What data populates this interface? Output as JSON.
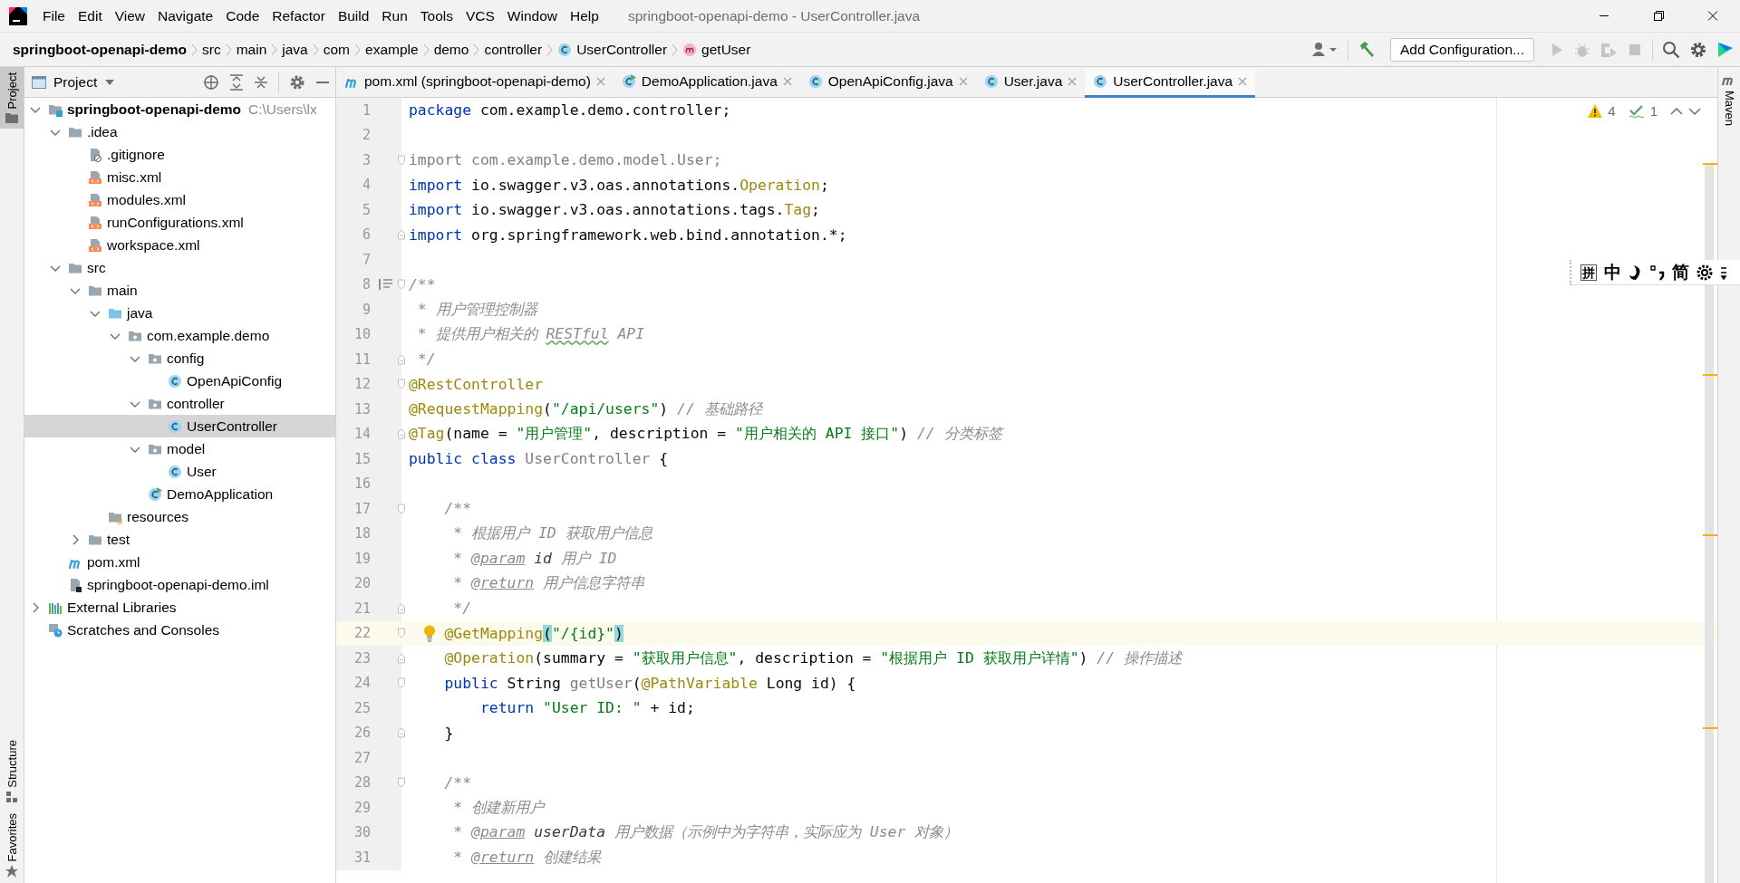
{
  "window": {
    "title": "springboot-openapi-demo - UserController.java"
  },
  "menu": [
    "File",
    "Edit",
    "View",
    "Navigate",
    "Code",
    "Refactor",
    "Build",
    "Run",
    "Tools",
    "VCS",
    "Window",
    "Help"
  ],
  "breadcrumbs": [
    {
      "label": "springboot-openapi-demo",
      "kind": "project"
    },
    {
      "label": "src",
      "kind": "dir"
    },
    {
      "label": "main",
      "kind": "dir"
    },
    {
      "label": "java",
      "kind": "dir"
    },
    {
      "label": "com",
      "kind": "dir"
    },
    {
      "label": "example",
      "kind": "dir"
    },
    {
      "label": "demo",
      "kind": "dir"
    },
    {
      "label": "controller",
      "kind": "dir"
    },
    {
      "label": "UserController",
      "kind": "class"
    },
    {
      "label": "getUser",
      "kind": "method"
    }
  ],
  "toolbar": {
    "run_config": "Add Configuration..."
  },
  "tool_stripe": {
    "left": {
      "top": [
        {
          "label": "Project",
          "selected": true
        }
      ],
      "bottom": [
        {
          "label": "Structure",
          "selected": false
        },
        {
          "label": "Favorites",
          "selected": false
        }
      ]
    },
    "right": {
      "top": [
        {
          "label": "Maven",
          "selected": false
        }
      ]
    }
  },
  "project_panel": {
    "title": "Project",
    "tree": [
      {
        "label": "springboot-openapi-demo",
        "kind": "module",
        "hint": "C:\\Users\\lx",
        "expanded": true,
        "selected": false,
        "children": [
          {
            "label": ".idea",
            "kind": "folder",
            "expanded": true,
            "selected": false,
            "children": [
              {
                "label": ".gitignore",
                "kind": "gitignore",
                "selected": false
              },
              {
                "label": "misc.xml",
                "kind": "xml",
                "selected": false
              },
              {
                "label": "modules.xml",
                "kind": "xml",
                "selected": false
              },
              {
                "label": "runConfigurations.xml",
                "kind": "xml",
                "selected": false
              },
              {
                "label": "workspace.xml",
                "kind": "xml",
                "selected": false
              }
            ]
          },
          {
            "label": "src",
            "kind": "folder",
            "expanded": true,
            "selected": false,
            "children": [
              {
                "label": "main",
                "kind": "folder",
                "expanded": true,
                "selected": false,
                "children": [
                  {
                    "label": "java",
                    "kind": "source",
                    "expanded": true,
                    "selected": false,
                    "children": [
                      {
                        "label": "com.example.demo",
                        "kind": "package",
                        "expanded": true,
                        "selected": false,
                        "children": [
                          {
                            "label": "config",
                            "kind": "package",
                            "expanded": true,
                            "selected": false,
                            "children": [
                              {
                                "label": "OpenApiConfig",
                                "kind": "class",
                                "selected": false
                              }
                            ]
                          },
                          {
                            "label": "controller",
                            "kind": "package",
                            "expanded": true,
                            "selected": false,
                            "children": [
                              {
                                "label": "UserController",
                                "kind": "class",
                                "selected": true
                              }
                            ]
                          },
                          {
                            "label": "model",
                            "kind": "package",
                            "expanded": true,
                            "selected": false,
                            "children": [
                              {
                                "label": "User",
                                "kind": "class",
                                "selected": false
                              }
                            ]
                          },
                          {
                            "label": "DemoApplication",
                            "kind": "app",
                            "selected": false
                          }
                        ]
                      }
                    ]
                  },
                  {
                    "label": "resources",
                    "kind": "resources",
                    "selected": false
                  }
                ]
              },
              {
                "label": "test",
                "kind": "folder",
                "expanded": false,
                "selected": false
              }
            ]
          },
          {
            "label": "pom.xml",
            "kind": "maven",
            "selected": false
          },
          {
            "label": "springboot-openapi-demo.iml",
            "kind": "iml",
            "selected": false
          }
        ]
      },
      {
        "label": "External Libraries",
        "kind": "libraries",
        "expanded": false,
        "selected": false
      },
      {
        "label": "Scratches and Consoles",
        "kind": "scratches",
        "selected": false
      }
    ]
  },
  "editor": {
    "tabs": [
      {
        "label": "pom.xml (springboot-openapi-demo)",
        "kind": "maven",
        "selected": false
      },
      {
        "label": "DemoApplication.java",
        "kind": "app",
        "selected": false
      },
      {
        "label": "OpenApiConfig.java",
        "kind": "class",
        "selected": false
      },
      {
        "label": "User.java",
        "kind": "class",
        "selected": false
      },
      {
        "label": "UserController.java",
        "kind": "class",
        "selected": true
      }
    ],
    "inspections": {
      "warnings": "4",
      "typos": "1"
    },
    "lines": [
      {
        "number": "1",
        "current": false,
        "tokens": [
          {
            "kind": "kw",
            "text": "package"
          },
          {
            "kind": "plain",
            "text": " com.example.demo.controller;"
          }
        ]
      },
      {
        "number": "2",
        "current": false
      },
      {
        "number": "3",
        "current": false,
        "fold": {
          "kind": "open"
        },
        "tokens": [
          {
            "kind": "unused",
            "text": "import com.example.demo.model.User;"
          }
        ]
      },
      {
        "number": "4",
        "current": false,
        "tokens": [
          {
            "kind": "kw",
            "text": "import"
          },
          {
            "kind": "plain",
            "text": " io.swagger.v3.oas.annotations."
          },
          {
            "kind": "ann",
            "text": "Operation"
          },
          {
            "kind": "plain",
            "text": ";"
          }
        ]
      },
      {
        "number": "5",
        "current": false,
        "tokens": [
          {
            "kind": "kw",
            "text": "import"
          },
          {
            "kind": "plain",
            "text": " io.swagger.v3.oas.annotations.tags."
          },
          {
            "kind": "ann",
            "text": "Tag"
          },
          {
            "kind": "plain",
            "text": ";"
          }
        ]
      },
      {
        "number": "6",
        "current": false,
        "fold": {
          "kind": "close"
        },
        "tokens": [
          {
            "kind": "kw",
            "text": "import"
          },
          {
            "kind": "plain",
            "text": " org.springframework.web.bind.annotation.*;"
          }
        ]
      },
      {
        "number": "7",
        "current": false
      },
      {
        "number": "8",
        "current": false,
        "fold": {
          "kind": "open"
        },
        "gutter_icon": {
          "kind": "doc"
        },
        "tokens": [
          {
            "kind": "cmt",
            "text": "/**"
          }
        ]
      },
      {
        "number": "9",
        "current": false,
        "tokens": [
          {
            "kind": "cmt",
            "text": " * 用户管理控制器"
          }
        ]
      },
      {
        "number": "10",
        "current": false,
        "tokens": [
          {
            "kind": "cmt",
            "text": " * 提供用户相关的 "
          },
          {
            "kind": "typo",
            "text": "RESTful"
          },
          {
            "kind": "cmt",
            "text": " API"
          }
        ]
      },
      {
        "number": "11",
        "current": false,
        "fold": {
          "kind": "close"
        },
        "tokens": [
          {
            "kind": "cmt",
            "text": " */"
          }
        ]
      },
      {
        "number": "12",
        "current": false,
        "fold": {
          "kind": "open"
        },
        "tokens": [
          {
            "kind": "ann",
            "text": "@RestController"
          }
        ]
      },
      {
        "number": "13",
        "current": false,
        "tokens": [
          {
            "kind": "ann",
            "text": "@RequestMapping"
          },
          {
            "kind": "plain",
            "text": "("
          },
          {
            "kind": "str",
            "text": "\"/api/users\""
          },
          {
            "kind": "plain",
            "text": ") "
          },
          {
            "kind": "cmt",
            "text": "// 基础路径"
          }
        ]
      },
      {
        "number": "14",
        "current": false,
        "fold": {
          "kind": "close"
        },
        "tokens": [
          {
            "kind": "ann",
            "text": "@Tag"
          },
          {
            "kind": "plain",
            "text": "(name = "
          },
          {
            "kind": "str",
            "text": "\"用户管理\""
          },
          {
            "kind": "plain",
            "text": ", description = "
          },
          {
            "kind": "str",
            "text": "\"用户相关的 API 接口\""
          },
          {
            "kind": "plain",
            "text": ") "
          },
          {
            "kind": "cmt",
            "text": "// 分类标签"
          }
        ]
      },
      {
        "number": "15",
        "current": false,
        "tokens": [
          {
            "kind": "kw",
            "text": "public class "
          },
          {
            "kind": "unused",
            "text": "UserController"
          },
          {
            "kind": "plain",
            "text": " {"
          }
        ]
      },
      {
        "number": "16",
        "current": false
      },
      {
        "number": "17",
        "current": false,
        "fold": {
          "kind": "open"
        },
        "tokens": [
          {
            "kind": "cmt",
            "text": "    /**"
          }
        ]
      },
      {
        "number": "18",
        "current": false,
        "tokens": [
          {
            "kind": "cmt",
            "text": "     * 根据用户 ID 获取用户信息"
          }
        ]
      },
      {
        "number": "19",
        "current": false,
        "tokens": [
          {
            "kind": "cmt",
            "text": "     * "
          },
          {
            "kind": "doctag",
            "text": "@param"
          },
          {
            "kind": "docid",
            "text": " id"
          },
          {
            "kind": "cmt",
            "text": " 用户 ID"
          }
        ]
      },
      {
        "number": "20",
        "current": false,
        "tokens": [
          {
            "kind": "cmt",
            "text": "     * "
          },
          {
            "kind": "doctag",
            "text": "@return"
          },
          {
            "kind": "cmt",
            "text": " 用户信息字符串"
          }
        ]
      },
      {
        "number": "21",
        "current": false,
        "fold": {
          "kind": "close"
        },
        "tokens": [
          {
            "kind": "cmt",
            "text": "     */"
          }
        ]
      },
      {
        "number": "22",
        "current": true,
        "fold": {
          "kind": "open"
        },
        "gutter_icon": {
          "kind": "bulb"
        },
        "tokens": [
          {
            "kind": "ann",
            "text": "    @GetMapping"
          },
          {
            "kind": "brace",
            "text": "("
          },
          {
            "kind": "str",
            "text": "\"/{id}\""
          },
          {
            "kind": "brace",
            "text": ")"
          }
        ]
      },
      {
        "number": "23",
        "current": false,
        "fold": {
          "kind": "close"
        },
        "tokens": [
          {
            "kind": "ann",
            "text": "    @Operation"
          },
          {
            "kind": "plain",
            "text": "(summary = "
          },
          {
            "kind": "str",
            "text": "\"获取用户信息\""
          },
          {
            "kind": "plain",
            "text": ", description = "
          },
          {
            "kind": "str",
            "text": "\"根据用户 ID 获取用户详情\""
          },
          {
            "kind": "plain",
            "text": ") "
          },
          {
            "kind": "cmt",
            "text": "// 操作描述"
          }
        ]
      },
      {
        "number": "24",
        "current": false,
        "fold": {
          "kind": "open"
        },
        "tokens": [
          {
            "kind": "kw",
            "text": "    public"
          },
          {
            "kind": "plain",
            "text": " String "
          },
          {
            "kind": "unused",
            "text": "getUser"
          },
          {
            "kind": "plain",
            "text": "("
          },
          {
            "kind": "ann",
            "text": "@PathVariable"
          },
          {
            "kind": "plain",
            "text": " Long id) {"
          }
        ]
      },
      {
        "number": "25",
        "current": false,
        "tokens": [
          {
            "kind": "kw",
            "text": "        return"
          },
          {
            "kind": "str",
            "text": " \"User ID: \""
          },
          {
            "kind": "plain",
            "text": " + id;"
          }
        ]
      },
      {
        "number": "26",
        "current": false,
        "fold": {
          "kind": "close"
        },
        "tokens": [
          {
            "kind": "plain",
            "text": "    }"
          }
        ]
      },
      {
        "number": "27",
        "current": false
      },
      {
        "number": "28",
        "current": false,
        "fold": {
          "kind": "open"
        },
        "tokens": [
          {
            "kind": "cmt",
            "text": "    /**"
          }
        ]
      },
      {
        "number": "29",
        "current": false,
        "tokens": [
          {
            "kind": "cmt",
            "text": "     * 创建新用户"
          }
        ]
      },
      {
        "number": "30",
        "current": false,
        "tokens": [
          {
            "kind": "cmt",
            "text": "     * "
          },
          {
            "kind": "doctag",
            "text": "@param"
          },
          {
            "kind": "docid",
            "text": " userData"
          },
          {
            "kind": "cmt",
            "text": " 用户数据（示例中为字符串，实际应为 User 对象）"
          }
        ]
      },
      {
        "number": "31",
        "current": false,
        "tokens": [
          {
            "kind": "cmt",
            "text": "     * "
          },
          {
            "kind": "doctag",
            "text": "@return"
          },
          {
            "kind": "cmt",
            "text": " 创建结果"
          }
        ]
      }
    ]
  },
  "ime_bar": [
    {
      "kind": "text",
      "text": "拼"
    },
    {
      "kind": "text",
      "text": "中"
    },
    {
      "kind": "moon"
    },
    {
      "kind": "punct"
    },
    {
      "kind": "text",
      "text": "简"
    },
    {
      "kind": "gear"
    },
    {
      "kind": "more"
    }
  ]
}
